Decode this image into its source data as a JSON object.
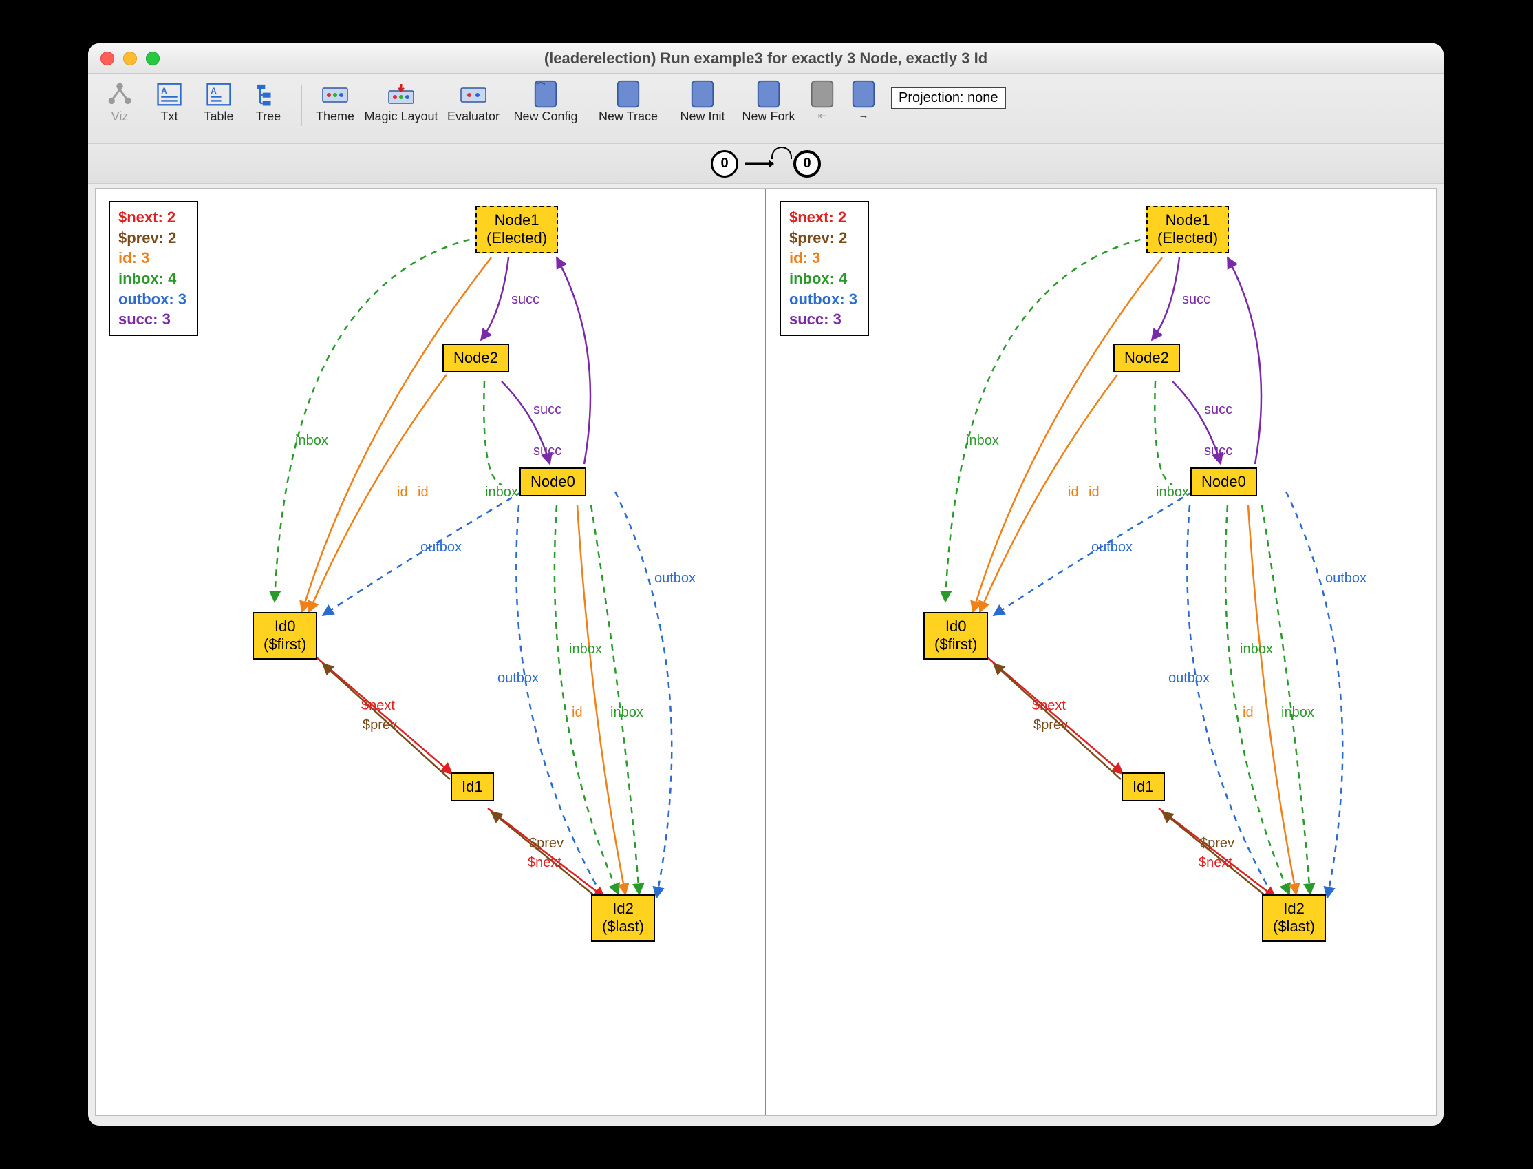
{
  "window": {
    "title": "(leaderelection) Run example3 for exactly 3 Node, exactly 3 Id"
  },
  "toolbar": {
    "items": [
      {
        "label": "Viz"
      },
      {
        "label": "Txt"
      },
      {
        "label": "Table"
      },
      {
        "label": "Tree"
      },
      {
        "label": "Theme"
      },
      {
        "label": "Magic Layout"
      },
      {
        "label": "Evaluator"
      },
      {
        "label": "New Config"
      },
      {
        "label": "New Trace"
      },
      {
        "label": "New Init"
      },
      {
        "label": "New Fork"
      },
      {
        "label": "⇤"
      },
      {
        "label": "→"
      }
    ],
    "projection": "Projection: none"
  },
  "states": {
    "left": "0",
    "right": "0"
  },
  "legend": {
    "next": "$next: 2",
    "prev": "$prev: 2",
    "id": "id: 3",
    "inbox": "inbox: 4",
    "outbox": "outbox: 3",
    "succ": "succ: 3"
  },
  "nodes": {
    "node1_l1": "Node1",
    "node1_l2": "(Elected)",
    "node2": "Node2",
    "node0": "Node0",
    "id0_l1": "Id0",
    "id0_l2": "($first)",
    "id1": "Id1",
    "id2_l1": "Id2",
    "id2_l2": "($last)"
  },
  "edgeLabels": {
    "succ": "succ",
    "inbox": "inbox",
    "outbox": "outbox",
    "id": "id",
    "next": "$next",
    "prev": "$prev"
  },
  "chart_data": {
    "type": "graph",
    "title": "Alloy instance visualization — leader election trace (two identical states)",
    "nodes": [
      {
        "name": "Node0",
        "type": "Node"
      },
      {
        "name": "Node1",
        "type": "Node",
        "attrs": [
          "Elected"
        ]
      },
      {
        "name": "Node2",
        "type": "Node"
      },
      {
        "name": "Id0",
        "type": "Id",
        "attrs": [
          "$first"
        ]
      },
      {
        "name": "Id1",
        "type": "Id"
      },
      {
        "name": "Id2",
        "type": "Id",
        "attrs": [
          "$last"
        ]
      }
    ],
    "relations": [
      {
        "name": "succ",
        "color": "#7a2aa8",
        "pairs": [
          [
            "Node1",
            "Node2"
          ],
          [
            "Node2",
            "Node0"
          ],
          [
            "Node0",
            "Node1"
          ]
        ]
      },
      {
        "name": "id",
        "color": "#f08018",
        "pairs": [
          [
            "Node1",
            "Id0"
          ],
          [
            "Node2",
            "Id0"
          ],
          [
            "Node0",
            "Id2"
          ]
        ]
      },
      {
        "name": "inbox",
        "color": "#2a9a2a",
        "pairs": [
          [
            "Node1",
            "Id0"
          ],
          [
            "Node0",
            "Id2"
          ],
          [
            "Node2",
            "Id2"
          ],
          [
            "Node0",
            "Id2"
          ]
        ]
      },
      {
        "name": "outbox",
        "color": "#2a6bcf",
        "pairs": [
          [
            "Node0",
            "Id0"
          ],
          [
            "Node2",
            "Id2"
          ],
          [
            "Node0",
            "Id2"
          ]
        ]
      },
      {
        "name": "$next",
        "color": "#e02020",
        "pairs": [
          [
            "Id0",
            "Id1"
          ],
          [
            "Id1",
            "Id2"
          ]
        ]
      },
      {
        "name": "$prev",
        "color": "#7a4a18",
        "pairs": [
          [
            "Id1",
            "Id0"
          ],
          [
            "Id2",
            "Id1"
          ]
        ]
      }
    ],
    "legend_counts": {
      "$next": 2,
      "$prev": 2,
      "id": 3,
      "inbox": 4,
      "outbox": 3,
      "succ": 3
    },
    "trace": {
      "states": [
        0,
        0
      ],
      "loop_back_to": 0
    }
  }
}
